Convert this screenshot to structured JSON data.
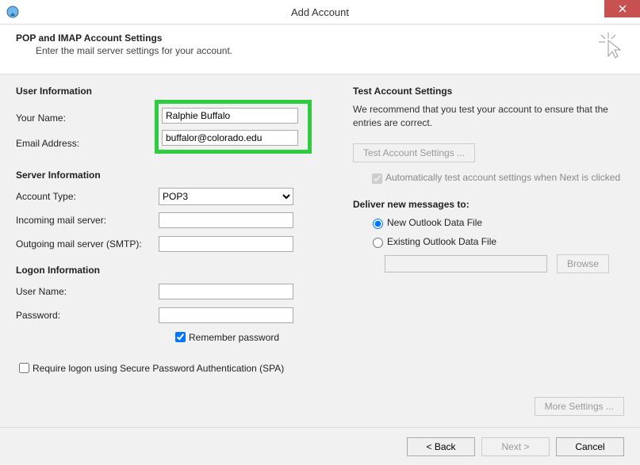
{
  "window": {
    "title": "Add Account"
  },
  "header": {
    "heading": "POP and IMAP Account Settings",
    "subheading": "Enter the mail server settings for your account."
  },
  "left": {
    "user_info_head": "User Information",
    "your_name_label": "Your Name:",
    "your_name_value": "Ralphie Buffalo",
    "email_label": "Email Address:",
    "email_value": "buffalor@colorado.edu",
    "server_info_head": "Server Information",
    "account_type_label": "Account Type:",
    "account_type_value": "POP3",
    "incoming_label": "Incoming mail server:",
    "incoming_value": "",
    "outgoing_label": "Outgoing mail server (SMTP):",
    "outgoing_value": "",
    "logon_info_head": "Logon Information",
    "user_name_label": "User Name:",
    "user_name_value": "",
    "password_label": "Password:",
    "password_value": "",
    "remember_label": "Remember password",
    "spa_label": "Require logon using Secure Password Authentication (SPA)"
  },
  "right": {
    "test_head": "Test Account Settings",
    "test_text": "We recommend that you test your account to ensure that the entries are correct.",
    "test_button": "Test Account Settings ...",
    "auto_test_label": "Automatically test account settings when Next is clicked",
    "deliver_head": "Deliver new messages to:",
    "radio_new": "New Outlook Data File",
    "radio_existing": "Existing Outlook Data File",
    "browse_button": "Browse",
    "more_settings": "More Settings ..."
  },
  "footer": {
    "back": "< Back",
    "next": "Next >",
    "cancel": "Cancel"
  }
}
